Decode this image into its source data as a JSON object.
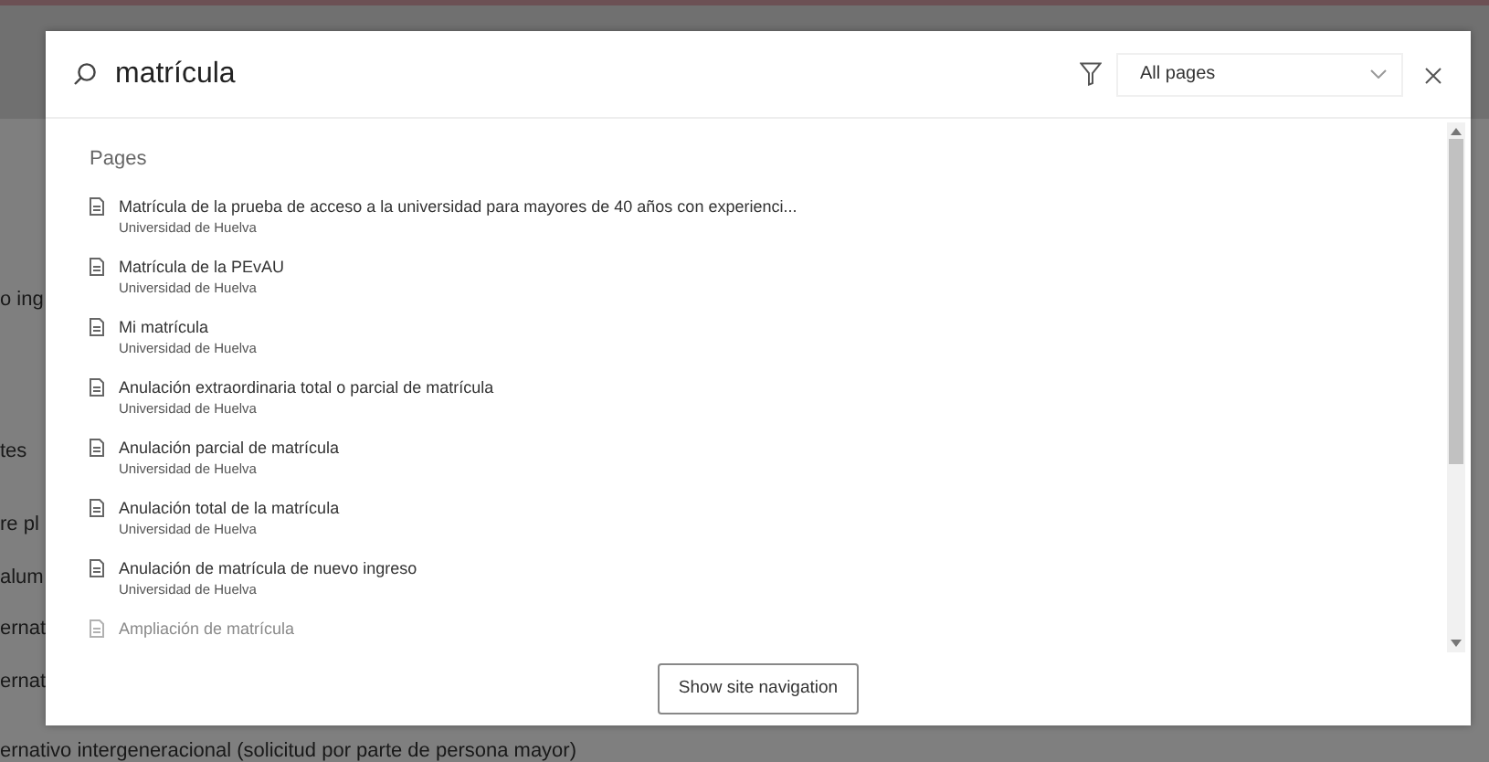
{
  "background_page": {
    "lines": [
      "o ing",
      "tes",
      "re pl",
      "alum",
      "ernat",
      "ernat",
      "ernativo intergeneracional (solicitud por parte de persona mayor)"
    ]
  },
  "search_dialog": {
    "search": {
      "value": "matrícula"
    },
    "scope_select": {
      "value": "All pages"
    },
    "results": {
      "heading": "Pages",
      "items": [
        {
          "title": "Matrícula de la prueba de acceso a la universidad para mayores de 40 años con experienci...",
          "source": "Universidad de Huelva",
          "faded": false
        },
        {
          "title": "Matrícula de la PEvAU",
          "source": "Universidad de Huelva",
          "faded": false
        },
        {
          "title": "Mi matrícula",
          "source": "Universidad de Huelva",
          "faded": false
        },
        {
          "title": "Anulación extraordinaria total o parcial de matrícula",
          "source": "Universidad de Huelva",
          "faded": false
        },
        {
          "title": "Anulación parcial de matrícula",
          "source": "Universidad de Huelva",
          "faded": false
        },
        {
          "title": "Anulación total de la matrícula",
          "source": "Universidad de Huelva",
          "faded": false
        },
        {
          "title": "Anulación de matrícula de nuevo ingreso",
          "source": "Universidad de Huelva",
          "faded": false
        },
        {
          "title": "Ampliación de matrícula",
          "faded": true
        }
      ]
    },
    "footer_button": "Show site navigation"
  }
}
